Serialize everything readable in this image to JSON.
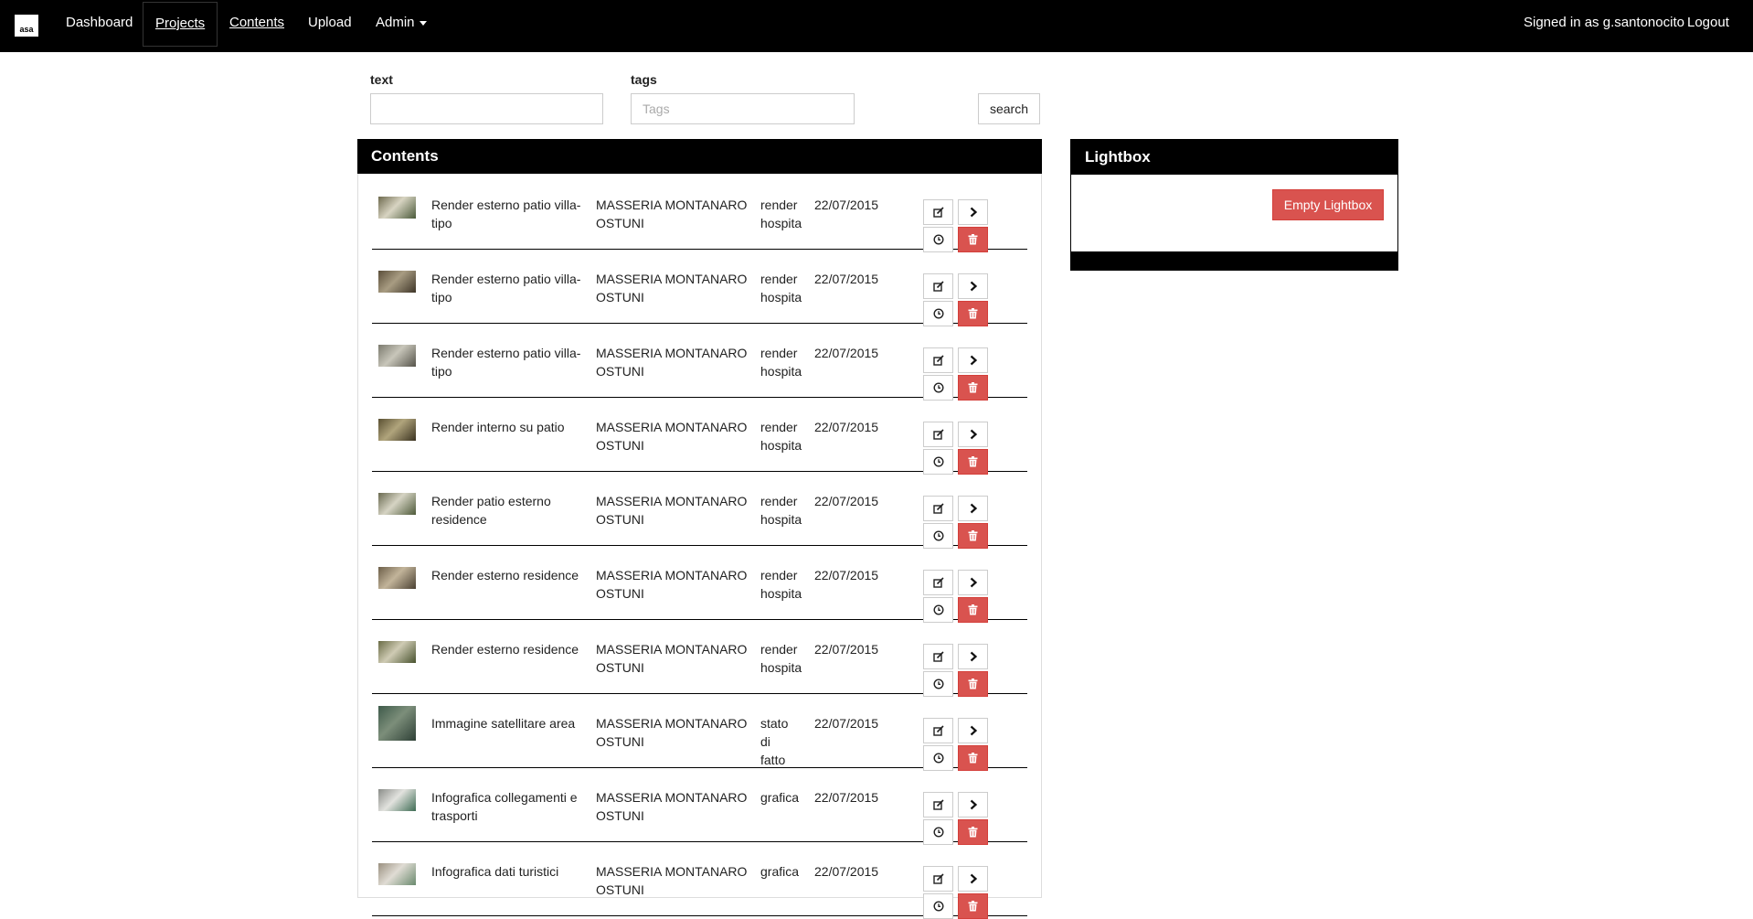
{
  "navbar": {
    "logo": "asa",
    "items": [
      "Dashboard",
      "Projects",
      "Contents",
      "Upload",
      "Admin"
    ],
    "signed_in": "Signed in as g.santonocito",
    "logout": "Logout"
  },
  "search": {
    "text_label": "text",
    "tags_label": "tags",
    "text_value": "",
    "tags_placeholder": "Tags",
    "button": "search"
  },
  "contents": {
    "title": "Contents",
    "rows": [
      {
        "title": "Render esterno patio villa-tipo",
        "project": "MASSERIA MONTANARO OSTUNI",
        "tags": "render hospita",
        "date": "22/07/2015"
      },
      {
        "title": "Render esterno patio villa-tipo",
        "project": "MASSERIA MONTANARO OSTUNI",
        "tags": "render hospita",
        "date": "22/07/2015"
      },
      {
        "title": "Render esterno patio villa-tipo",
        "project": "MASSERIA MONTANARO OSTUNI",
        "tags": "render hospita",
        "date": "22/07/2015"
      },
      {
        "title": "Render interno su patio",
        "project": "MASSERIA MONTANARO OSTUNI",
        "tags": "render hospita",
        "date": "22/07/2015"
      },
      {
        "title": "Render patio esterno residence",
        "project": "MASSERIA MONTANARO OSTUNI",
        "tags": "render hospita",
        "date": "22/07/2015"
      },
      {
        "title": "Render esterno residence",
        "project": "MASSERIA MONTANARO OSTUNI",
        "tags": "render hospita",
        "date": "22/07/2015"
      },
      {
        "title": "Render esterno residence",
        "project": "MASSERIA MONTANARO OSTUNI",
        "tags": "render hospita",
        "date": "22/07/2015"
      },
      {
        "title": "Immagine satellitare area",
        "project": "MASSERIA MONTANARO OSTUNI",
        "tags": "stato di fatto",
        "date": "22/07/2015"
      },
      {
        "title": "Infografica collegamenti e trasporti",
        "project": "MASSERIA MONTANARO OSTUNI",
        "tags": "grafica",
        "date": "22/07/2015"
      },
      {
        "title": "Infografica dati turistici",
        "project": "MASSERIA MONTANARO OSTUNI",
        "tags": "grafica",
        "date": "22/07/2015"
      }
    ]
  },
  "lightbox": {
    "title": "Lightbox",
    "empty_button": "Empty Lightbox"
  },
  "colors": {
    "navbar_bg": "#000000",
    "danger": "#d9534f"
  },
  "icons": [
    "edit-icon",
    "chevron-right-icon",
    "clock-icon",
    "trash-icon"
  ]
}
